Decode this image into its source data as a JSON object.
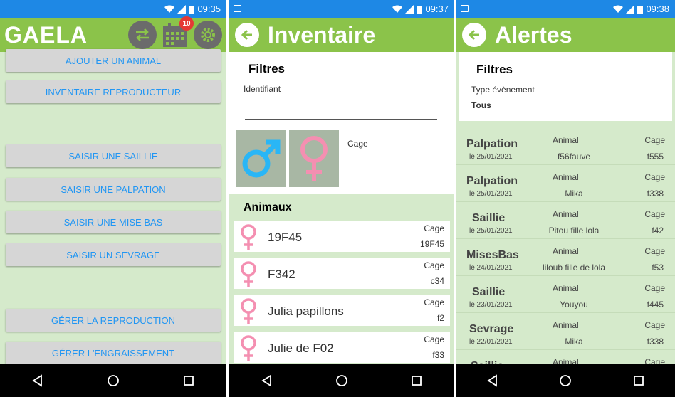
{
  "colors": {
    "status_bar": "#1e88e5",
    "app_bar": "#8bc34a",
    "background": "#d5eacb",
    "accent_text": "#2196f3",
    "female": "#f48fb1",
    "male": "#29b6f6",
    "badge": "#e53935"
  },
  "screen1": {
    "status_time": "09:35",
    "title": "GAELA",
    "calendar_badge": "10",
    "buttons": [
      "AJOUTER UN ANIMAL",
      "INVENTAIRE REPRODUCTEUR",
      "SAISIR UNE SAILLIE",
      "SAISIR UNE PALPATION",
      "SAISIR UNE MISE BAS",
      "SAISIR UN SEVRAGE",
      "GÉRER LA REPRODUCTION",
      "GÉRER L'ENGRAISSEMENT"
    ]
  },
  "screen2": {
    "status_time": "09:37",
    "title": "Inventaire",
    "filters_title": "Filtres",
    "identifier_label": "Identifiant",
    "identifier_value": "",
    "cage_label": "Cage",
    "cage_value": "",
    "animals_title": "Animaux",
    "animals": [
      {
        "name": "19F45",
        "cage_label": "Cage",
        "cage": "19F45"
      },
      {
        "name": "F342",
        "cage_label": "Cage",
        "cage": "c34"
      },
      {
        "name": "Julia papillons",
        "cage_label": "Cage",
        "cage": "f2"
      },
      {
        "name": "Julie de F02",
        "cage_label": "Cage",
        "cage": "f33"
      }
    ]
  },
  "screen3": {
    "status_time": "09:38",
    "title": "Alertes",
    "filters_title": "Filtres",
    "event_type_label": "Type évènement",
    "event_type_value": "Tous",
    "alerts": [
      {
        "type": "Palpation",
        "date": "le 25/01/2021",
        "animal_label": "Animal",
        "animal": "f56fauve",
        "cage_label": "Cage",
        "cage": "f555"
      },
      {
        "type": "Palpation",
        "date": "le 25/01/2021",
        "animal_label": "Animal",
        "animal": "Mika",
        "cage_label": "Cage",
        "cage": "f338"
      },
      {
        "type": "Saillie",
        "date": "le 25/01/2021",
        "animal_label": "Animal",
        "animal": "Pitou fille lola",
        "cage_label": "Cage",
        "cage": "f42"
      },
      {
        "type": "MisesBas",
        "date": "le 24/01/2021",
        "animal_label": "Animal",
        "animal": "liloub fille de lola",
        "cage_label": "Cage",
        "cage": "f53"
      },
      {
        "type": "Saillie",
        "date": "le 23/01/2021",
        "animal_label": "Animal",
        "animal": "Youyou",
        "cage_label": "Cage",
        "cage": "f445"
      },
      {
        "type": "Sevrage",
        "date": "le 22/01/2021",
        "animal_label": "Animal",
        "animal": "Mika",
        "cage_label": "Cage",
        "cage": "f338"
      },
      {
        "type": "Saillie",
        "date": "",
        "animal_label": "Animal",
        "animal": "",
        "cage_label": "Cage",
        "cage": ""
      }
    ]
  }
}
